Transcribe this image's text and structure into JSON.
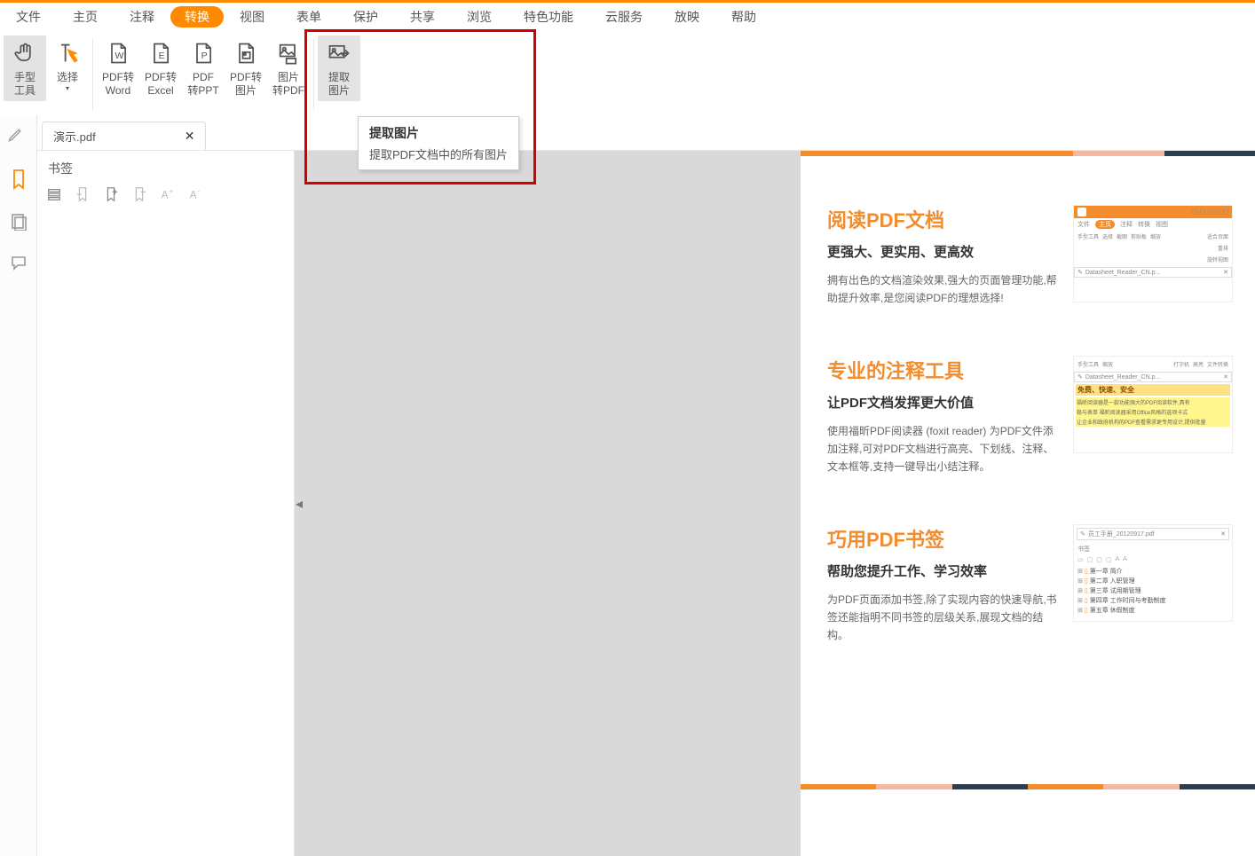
{
  "menu": [
    "文件",
    "主页",
    "注释",
    "转换",
    "视图",
    "表单",
    "保护",
    "共享",
    "浏览",
    "特色功能",
    "云服务",
    "放映",
    "帮助"
  ],
  "menu_active_index": 3,
  "ribbon": {
    "hand": "手型\n工具",
    "select": "选择",
    "pdf_word": "PDF转\nWord",
    "pdf_excel": "PDF转\nExcel",
    "pdf_ppt": "PDF\n转PPT",
    "pdf_image": "PDF转\n图片",
    "image_pdf": "图片\n转PDF",
    "extract_image": "提取\n图片"
  },
  "tooltip": {
    "title": "提取图片",
    "desc": "提取PDF文档中的所有图片"
  },
  "filetab_name": "演示.pdf",
  "bookmark_title": "书签",
  "page": {
    "s1": {
      "h2": "阅读PDF文档",
      "h3": "更强大、更实用、更高效",
      "p": "拥有出色的文档渲染效果,强大的页面管理功能,帮助提升效率,是您阅读PDF的理想选择!"
    },
    "s2": {
      "h2": "专业的注释工具",
      "h3": "让PDF文档发挥更大价值",
      "p": "使用福昕PDF阅读器 (foxit reader) 为PDF文件添加注释,可对PDF文档进行高亮、下划线、注释、文本框等,支持一键导出小结注释。"
    },
    "s3": {
      "h2": "巧用PDF书签",
      "h3": "帮助您提升工作、学习效率",
      "p": "为PDF页面添加书签,除了实现内容的快速导航,书签还能指明不同书签的层级关系,展现文档的结构。"
    }
  },
  "thumb": {
    "tabs": [
      "文件",
      "主页",
      "注释",
      "转换",
      "视图"
    ],
    "tools": [
      "手型工具",
      "选择",
      "截图",
      "剪贴板",
      "缩放"
    ],
    "side": [
      "适合页面",
      "重排",
      "旋转视图"
    ],
    "file1": "Datasheet_Reader_CN.p...",
    "s2_tools": [
      "手型工具",
      "缩放",
      "打字机",
      "高亮",
      "文件转换"
    ],
    "s2_highlight": "免费、快速、安全",
    "s2_line1": "福昕阅读器是一款功能强大的PDF阅读软件,具有",
    "s2_line2": "稳与表单 福昕阅读器采用Office风格的选项卡式",
    "s2_line3": "让企业和政府机构的PDF查看需求更专用设计,提供批量",
    "s3_file": "员工手册_20120917.pdf",
    "s3_title": "书签",
    "s3_items": [
      "第一章  简介",
      "第二章  入职管理",
      "第三章  试用期管理",
      "第四章  工作时间与考勤制度",
      "第五章  休假制度"
    ]
  }
}
